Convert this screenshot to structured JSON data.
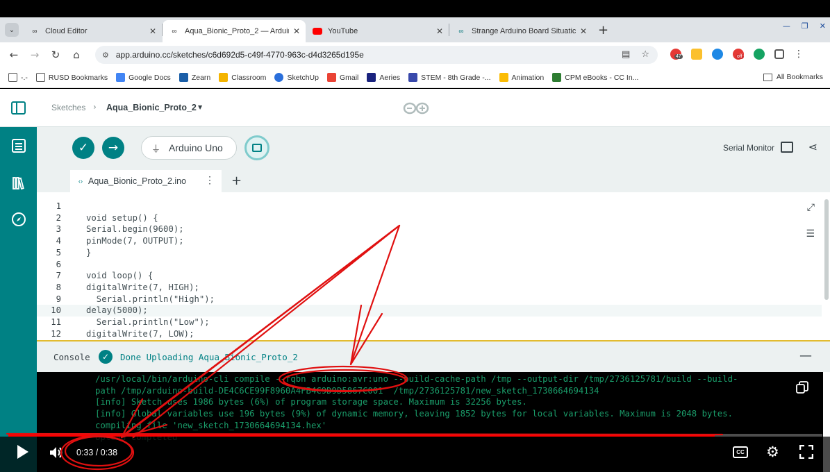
{
  "browser": {
    "tabs": [
      {
        "label": "Cloud Editor",
        "icon": "arduino-icon",
        "active": false
      },
      {
        "label": "Aqua_Bionic_Proto_2 — Arduin",
        "icon": "arduino-icon",
        "active": true
      },
      {
        "label": "YouTube",
        "icon": "youtube-icon",
        "active": false
      },
      {
        "label": "Strange Arduino Board Situatic",
        "icon": "arduino-icon",
        "active": false
      }
    ],
    "url": "app.arduino.cc/sketches/c6d692d5-c49f-4770-963c-d4d3265d195e",
    "badges": {
      "ext1": "47",
      "ext2": "off"
    },
    "bookmarks": [
      {
        "label": "-.-",
        "icon": "folder-icon"
      },
      {
        "label": "RUSD Bookmarks",
        "icon": "folder-icon"
      },
      {
        "label": "Google Docs",
        "icon": "docs-icon"
      },
      {
        "label": "Zearn",
        "icon": "zearn-icon"
      },
      {
        "label": "Classroom",
        "icon": "classroom-icon"
      },
      {
        "label": "SketchUp",
        "icon": "sketchup-icon"
      },
      {
        "label": "Gmail",
        "icon": "gmail-icon"
      },
      {
        "label": "Aeries",
        "icon": "aeries-icon"
      },
      {
        "label": "STEM - 8th Grade -...",
        "icon": "forms-icon"
      },
      {
        "label": "Animation",
        "icon": "slides-icon"
      },
      {
        "label": "CPM eBooks - CC In...",
        "icon": "cpm-icon"
      }
    ],
    "all_bookmarks": "All Bookmarks"
  },
  "app": {
    "breadcrumb_root": "Sketches",
    "sketch_name": "Aqua_Bionic_Proto_2",
    "board": "Arduino Uno",
    "serial_monitor": "Serial Monitor",
    "file_tab": "Aqua_Bionic_Proto_2.ino",
    "accent": "#008184",
    "code_lines": [
      {
        "n": "1",
        "text": ""
      },
      {
        "n": "2",
        "text": "void setup() {"
      },
      {
        "n": "3",
        "text": "Serial.begin(9600);"
      },
      {
        "n": "4",
        "text": "pinMode(7, OUTPUT);"
      },
      {
        "n": "5",
        "text": "}"
      },
      {
        "n": "6",
        "text": ""
      },
      {
        "n": "7",
        "text": "void loop() {"
      },
      {
        "n": "8",
        "text": "digitalWrite(7, HIGH);"
      },
      {
        "n": "9",
        "text": "  Serial.println(\"High\");"
      },
      {
        "n": "10",
        "text": "delay(5000);"
      },
      {
        "n": "11",
        "text": "  Serial.println(\"Low\");"
      },
      {
        "n": "12",
        "text": "digitalWrite(7, LOW);"
      }
    ],
    "console_title": "Console",
    "console_status": "Done Uploading Aqua_Bionic_Proto_2",
    "console_lines": [
      "/usr/local/bin/arduino-cli compile --fqbn arduino:avr:uno --build-cache-path /tmp --output-dir /tmp/2736125781/build --build-",
      "path /tmp/arduino-build-DE4C6CE99F8960A4FB4C9D9D5867C001  /tmp/2736125781/new_sketch_1730664694134",
      "[info] Sketch uses 1986 bytes (6%) of program storage space. Maximum is 32256 bytes.",
      "[info] Global variables use 196 bytes (9%) of dynamic memory, leaving 1852 bytes for local variables. Maximum is 2048 bytes.",
      "compiling file 'new_sketch_1730664694134.hex'",
      "Upload completed"
    ]
  },
  "player": {
    "time": "0:33 / 0:38",
    "progress": 0.868,
    "cc_label": "CC",
    "accent": "#ff0000"
  }
}
